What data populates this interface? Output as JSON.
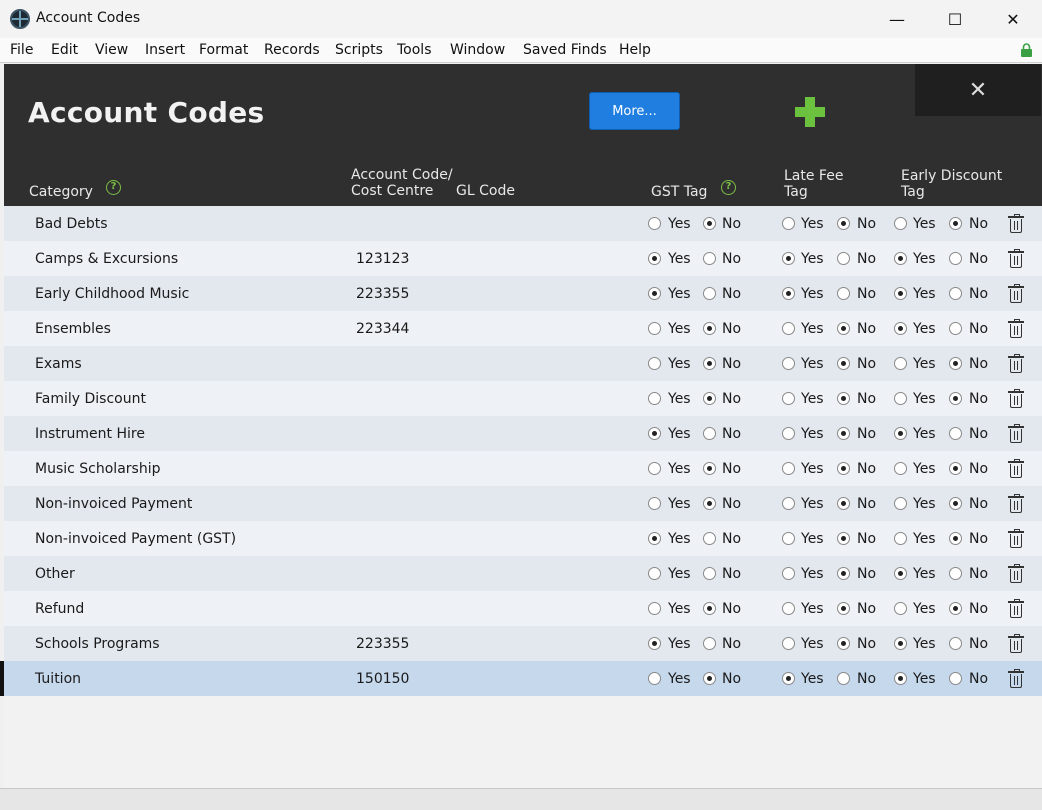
{
  "window": {
    "title": "Account Codes",
    "minimize": "—",
    "maximize": "☐",
    "close": "✕"
  },
  "menu": [
    "File",
    "Edit",
    "View",
    "Insert",
    "Format",
    "Records",
    "Scripts",
    "Tools",
    "Window",
    "Saved Finds",
    "Help"
  ],
  "header": {
    "title": "Account Codes",
    "more_label": "More...",
    "close_label": "✕"
  },
  "columns": {
    "category": "Category",
    "code_line1": "Account Code/",
    "code_line2": "Cost Centre",
    "gl_code": "GL Code",
    "gst_tag": "GST Tag",
    "late_fee_line1": "Late Fee",
    "late_fee_line2": "Tag",
    "early_line1": "Early Discount",
    "early_line2": "Tag"
  },
  "labels": {
    "yes": "Yes",
    "no": "No"
  },
  "rows": [
    {
      "category": "Bad Debts",
      "code": "",
      "gst": "No",
      "late": "No",
      "early": "No"
    },
    {
      "category": "Camps & Excursions",
      "code": "123123",
      "gst": "Yes",
      "late": "Yes",
      "early": "Yes"
    },
    {
      "category": "Early Childhood Music",
      "code": "223355",
      "gst": "Yes",
      "late": "Yes",
      "early": "Yes"
    },
    {
      "category": "Ensembles",
      "code": "223344",
      "gst": "No",
      "late": "No",
      "early": "Yes"
    },
    {
      "category": "Exams",
      "code": "",
      "gst": "No",
      "late": "No",
      "early": "No"
    },
    {
      "category": "Family Discount",
      "code": "",
      "gst": "No",
      "late": "No",
      "early": "No"
    },
    {
      "category": "Instrument Hire",
      "code": "",
      "gst": "Yes",
      "late": "No",
      "early": "Yes"
    },
    {
      "category": "Music Scholarship",
      "code": "",
      "gst": "No",
      "late": "No",
      "early": "No"
    },
    {
      "category": "Non-invoiced Payment",
      "code": "",
      "gst": "No",
      "late": "No",
      "early": "No"
    },
    {
      "category": "Non-invoiced Payment (GST)",
      "code": "",
      "gst": "Yes",
      "late": "No",
      "early": "No"
    },
    {
      "category": "Other",
      "code": "",
      "gst": "",
      "late": "No",
      "early": "Yes"
    },
    {
      "category": "Refund",
      "code": "",
      "gst": "No",
      "late": "No",
      "early": "No"
    },
    {
      "category": "Schools Programs",
      "code": "223355",
      "gst": "Yes",
      "late": "No",
      "early": "Yes"
    },
    {
      "category": "Tuition",
      "code": "150150",
      "gst": "No",
      "late": "Yes",
      "early": "Yes"
    }
  ],
  "selected_row": "Tuition",
  "colors": {
    "header_bg": "#2f2f2f",
    "accent_button": "#1f7ee0",
    "add_green": "#6cc13f",
    "row_alt": "#e3e8ef",
    "row_selected": "#c5d8ec"
  }
}
